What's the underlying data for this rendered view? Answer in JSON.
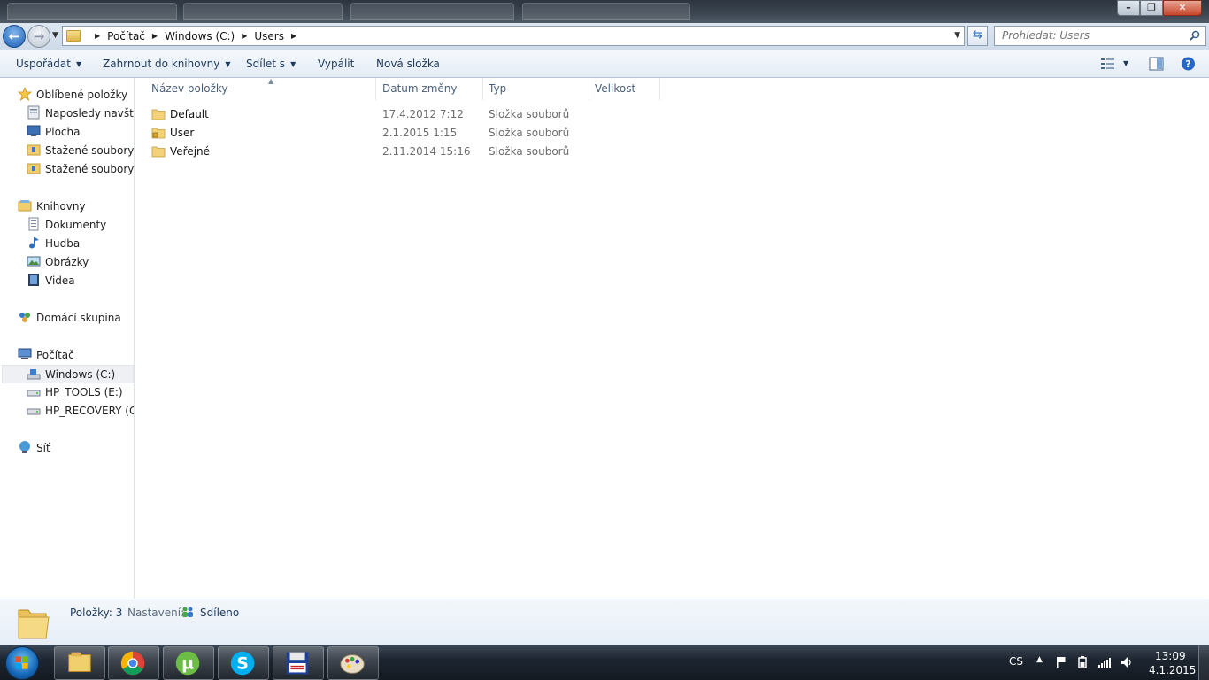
{
  "window": {
    "minimize_glyph": "–",
    "maximize_glyph": "❐",
    "close_glyph": "✕"
  },
  "address": {
    "crumbs": [
      "Počítač",
      "Windows (C:)",
      "Users"
    ],
    "search_placeholder": "Prohledat: Users"
  },
  "toolbar": {
    "organize": "Uspořádat",
    "include_library": "Zahrnout do knihovny",
    "share_with": "Sdílet s",
    "burn": "Vypálit",
    "new_folder": "Nová složka"
  },
  "nav": {
    "favorites": "Oblíbené položky",
    "recent": "Naposledy navštívené",
    "desktop": "Plocha",
    "downloads1": "Stažené soubory",
    "downloads2": "Stažené soubory",
    "libraries": "Knihovny",
    "documents": "Dokumenty",
    "music": "Hudba",
    "pictures": "Obrázky",
    "videos": "Videa",
    "homegroup": "Domácí skupina",
    "computer": "Počítač",
    "drive_c": "Windows (C:)",
    "drive_e": "HP_TOOLS (E:)",
    "drive_g": "HP_RECOVERY (G:)",
    "network": "Síť"
  },
  "columns": {
    "name": "Název položky",
    "date": "Datum změny",
    "type": "Typ",
    "size": "Velikost"
  },
  "files": [
    {
      "name": "Default",
      "date": "17.4.2012 7:12",
      "type": "Složka souborů"
    },
    {
      "name": "User",
      "date": "2.1.2015 1:15",
      "type": "Složka souborů"
    },
    {
      "name": "Veřejné",
      "date": "2.11.2014 15:16",
      "type": "Složka souborů"
    }
  ],
  "details": {
    "items_label": "Položky: 3",
    "settings_label": "Nastavení:",
    "shared_label": "Sdíleno"
  },
  "taskbar": {
    "language": "CS",
    "time": "13:09",
    "date": "4.1.2015"
  },
  "icons": {
    "start": "windows-start-orb",
    "apps": [
      "explorer-icon",
      "chrome-icon",
      "utorrent-icon",
      "skype-icon",
      "floppy-app-icon",
      "paint-icon"
    ]
  }
}
